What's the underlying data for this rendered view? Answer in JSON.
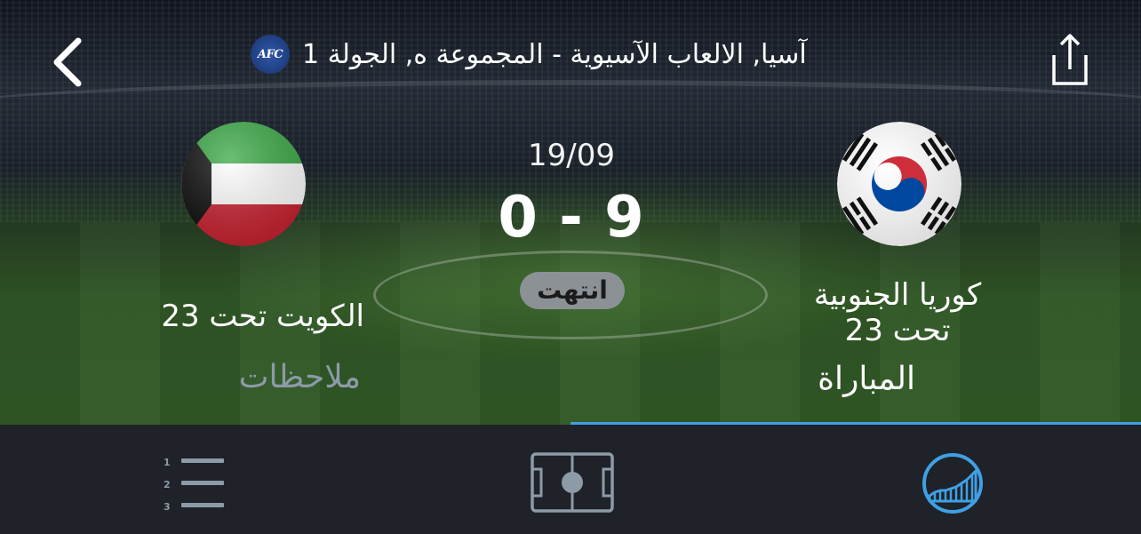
{
  "header": {
    "title": "آسيا, الالعاب الآسيوية - المجموعة ه, الجولة 1",
    "logo_text": "AFC",
    "back_icon": "chevron-left-icon",
    "share_icon": "share-icon"
  },
  "match": {
    "date": "19/09",
    "score": "0 - 9",
    "status": "انتهت",
    "home_team": {
      "name": "كوريا الجنوبية تحت 23",
      "flag": "south-korea-flag"
    },
    "away_team": {
      "name": "الكويت تحت 23",
      "flag": "kuwait-flag"
    }
  },
  "tabs": [
    {
      "label": "المباراة",
      "active": true
    },
    {
      "label": "ملاحظات",
      "active": false
    }
  ],
  "bottom_nav": [
    {
      "icon": "numbered-list-icon",
      "list_numbers": [
        "1",
        "2",
        "3"
      ]
    },
    {
      "icon": "pitch-icon"
    },
    {
      "icon": "stats-gauge-icon",
      "active": true
    }
  ],
  "colors": {
    "accent": "#3fa0e4",
    "inactive_icon": "#8d9aa8",
    "status_badge_bg": "#8c9196",
    "bottom_bar_bg": "#1f2228"
  }
}
